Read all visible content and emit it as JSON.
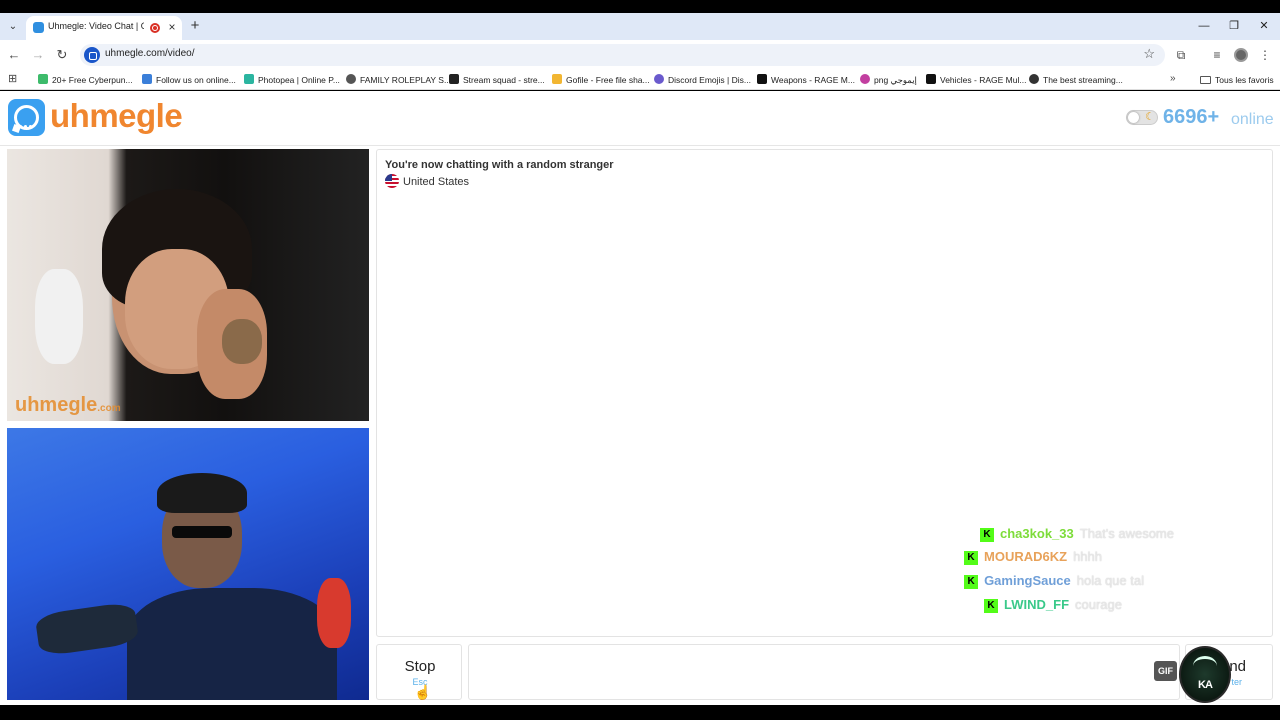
{
  "browser": {
    "tab": {
      "title": "Uhmegle: Video Chat | Omegle Alternative"
    },
    "url": "uhmegle.com/video/",
    "bookmarks": [
      "20+ Free Cyberpun...",
      "Follow us on online...",
      "Photopea | Online P...",
      "FAMILY ROLEPLAY S...",
      "Stream squad - stre...",
      "Gofile - Free file sha...",
      "Discord Emojis | Dis...",
      "Weapons - RAGE M...",
      "png إيموجي",
      "Vehicles - RAGE Mul...",
      "The best streaming..."
    ],
    "bookmarks_folder": "Tous les favoris"
  },
  "site": {
    "logo": "uhmegle",
    "online_count": "6696+",
    "online_label": "online"
  },
  "video": {
    "watermark": "uhmegle",
    "watermark_suffix": ".com"
  },
  "chat": {
    "status": "You're now chatting with a random stranger",
    "country": "United States"
  },
  "stream_chat": [
    {
      "name": "cha3kok_33",
      "text": "That's awesome",
      "color": "#7ddc3a"
    },
    {
      "name": "MOURAD6KZ",
      "text": "hhhh",
      "color": "#e8a25a"
    },
    {
      "name": "GamingSauce",
      "text": "hola que tal",
      "color": "#6f9fd8"
    },
    {
      "name": "LWIND_FF",
      "text": "courage",
      "color": "#3ac98a"
    }
  ],
  "controls": {
    "stop_label": "Stop",
    "stop_hint": "Esc",
    "gif_label": "GIF",
    "send_label": "nd",
    "send_hint": "ter",
    "overlay_logo_text": "KA"
  }
}
